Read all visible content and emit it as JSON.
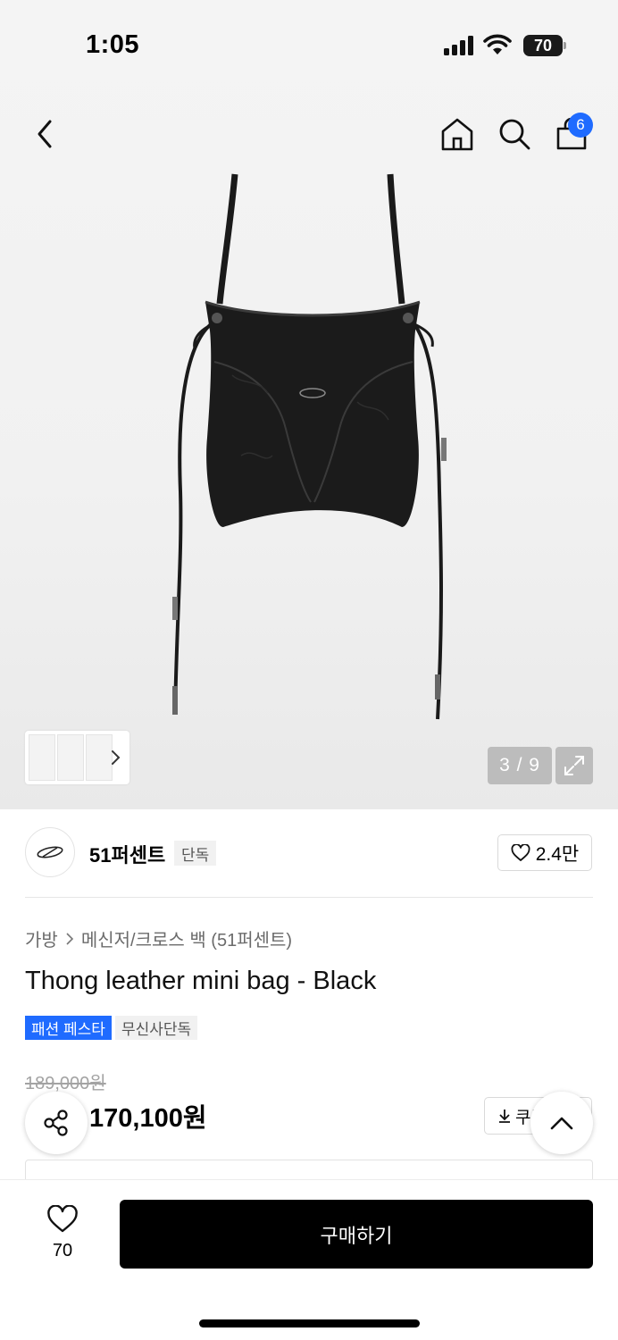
{
  "status_bar": {
    "time": "1:05",
    "battery": "70"
  },
  "nav": {
    "cart_count": "6"
  },
  "gallery": {
    "counter": "3 / 9"
  },
  "brand": {
    "name": "51퍼센트",
    "tag": "단독",
    "like_count": "2.4만"
  },
  "breadcrumb": {
    "category": "가방",
    "subcategory": "메신저/크로스 백 (51퍼센트)"
  },
  "product": {
    "title": "Thong leather mini bag - Black",
    "badges": [
      "패션 페스타",
      "무신사단독"
    ],
    "original_price": "189,000원",
    "sale_price": "170,100원",
    "coupon_label": "쿠폰"
  },
  "bottom_bar": {
    "wish_count": "70",
    "buy_label": "구매하기"
  },
  "colors": {
    "accent_blue": "#1f6bff",
    "buy_button": "#000000"
  }
}
